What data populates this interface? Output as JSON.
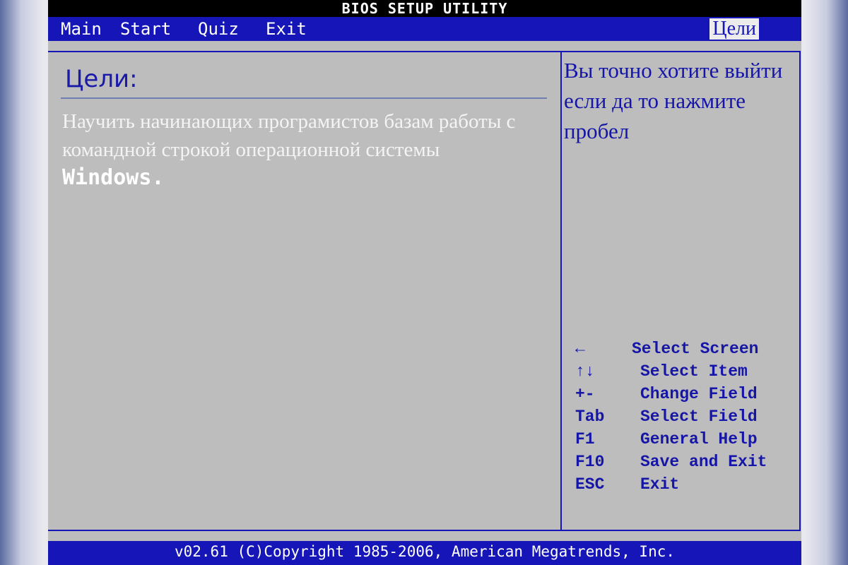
{
  "title_bar": "BIOS SETUP UTILITY",
  "menu": {
    "items": [
      "Main",
      "Start",
      "Quiz",
      "Exit"
    ],
    "active": "Цели"
  },
  "main": {
    "heading": "Цели:",
    "description": "Научить начинающих програмистов базам работы с командной строкой операционной системы",
    "windows_word": "Windows."
  },
  "help_panel": {
    "text": "Вы точно хотите выйти если да то нажмите пробел",
    "keys": [
      {
        "key": "←",
        "desc": "Select Screen"
      },
      {
        "key": "↑↓",
        "desc": "Select Item"
      },
      {
        "key": "+-",
        "desc": "Change Field"
      },
      {
        "key": "Tab",
        "desc": "Select Field"
      },
      {
        "key": "F1",
        "desc": "General Help"
      },
      {
        "key": "F10",
        "desc": "Save and Exit"
      },
      {
        "key": "ESC",
        "desc": "Exit"
      }
    ]
  },
  "footer": "v02.61 (C)Copyright 1985-2006, American Megatrends, Inc.",
  "colors": {
    "bios_blue": "#1515b8",
    "panel_gray": "#bdbdbd",
    "title_black": "#000000"
  }
}
